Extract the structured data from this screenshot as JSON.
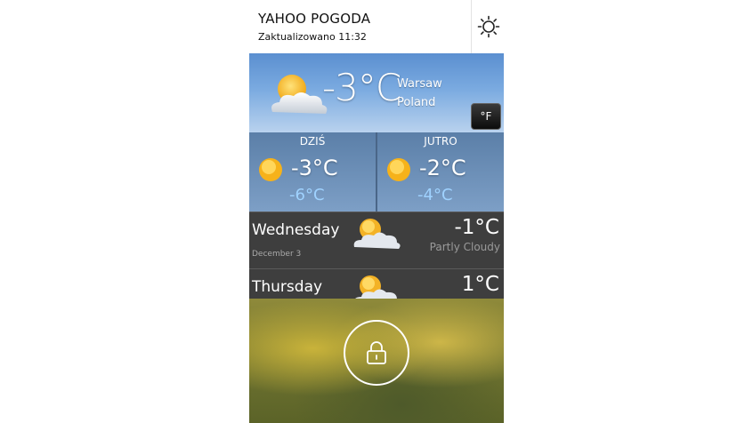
{
  "header": {
    "title": "YAHOO POGODA",
    "updated": "Zaktualizowano 11:32",
    "settings_icon": "brightness-settings-icon"
  },
  "current": {
    "temperature": "-3°C",
    "city": "Warsaw",
    "country": "Poland",
    "unit_toggle": "°F",
    "icon": "partly-cloudy-icon"
  },
  "days": [
    {
      "name": "DZIŚ",
      "high": "-3°C",
      "low": "-6°C",
      "icon": "sun-icon"
    },
    {
      "name": "JUTRO",
      "high": "-2°C",
      "low": "-4°C",
      "icon": "sun-icon"
    }
  ],
  "forecast": [
    {
      "day": "Wednesday",
      "date": "December 3",
      "temp": "-1°C",
      "condition": "Partly Cloudy",
      "icon": "partly-cloudy-icon"
    },
    {
      "day": "Thursday",
      "temp": "1°C",
      "icon": "partly-cloudy-icon"
    }
  ],
  "lock": {
    "icon": "lock-icon"
  },
  "colors": {
    "header_bg": "#ffffff",
    "sky": "#6d9fdb",
    "row_bg": "#3e3e3e",
    "low_temp": "#9fd2ff"
  }
}
